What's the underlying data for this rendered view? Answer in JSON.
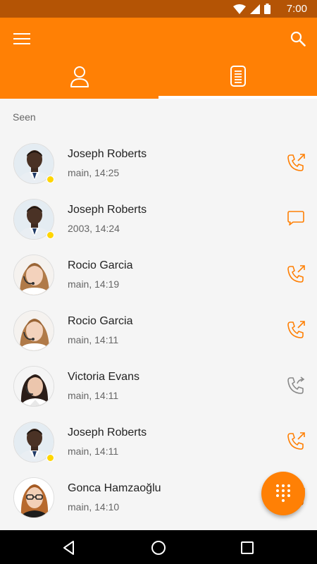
{
  "status_bar": {
    "time": "7:00"
  },
  "toolbar": {
    "active_tab": "history"
  },
  "section": {
    "title": "Seen"
  },
  "calls": [
    {
      "name": "Joseph Roberts",
      "detail": "main, 14:25",
      "type": "outgoing-call",
      "avatar": "joseph",
      "presence": true
    },
    {
      "name": "Joseph Roberts",
      "detail": "2003, 14:24",
      "type": "chat",
      "avatar": "joseph",
      "presence": true
    },
    {
      "name": "Rocio Garcia",
      "detail": "main, 14:19",
      "type": "outgoing-call",
      "avatar": "rocio",
      "presence": false
    },
    {
      "name": "Rocio Garcia",
      "detail": "main, 14:11",
      "type": "outgoing-call",
      "avatar": "rocio",
      "presence": false
    },
    {
      "name": "Victoria Evans",
      "detail": "main, 14:11",
      "type": "forwarded-call",
      "avatar": "victoria",
      "presence": false
    },
    {
      "name": "Joseph Roberts",
      "detail": "main, 14:11",
      "type": "outgoing-call",
      "avatar": "joseph",
      "presence": true
    },
    {
      "name": "Gonca Hamzaoğlu",
      "detail": "main, 14:10",
      "type": "outgoing-call",
      "avatar": "gonca",
      "presence": false
    }
  ],
  "colors": {
    "accent": "#ff8005",
    "status_bar": "#b45405",
    "grey_icon": "#8a8a8a",
    "presence": "#ffd500"
  }
}
